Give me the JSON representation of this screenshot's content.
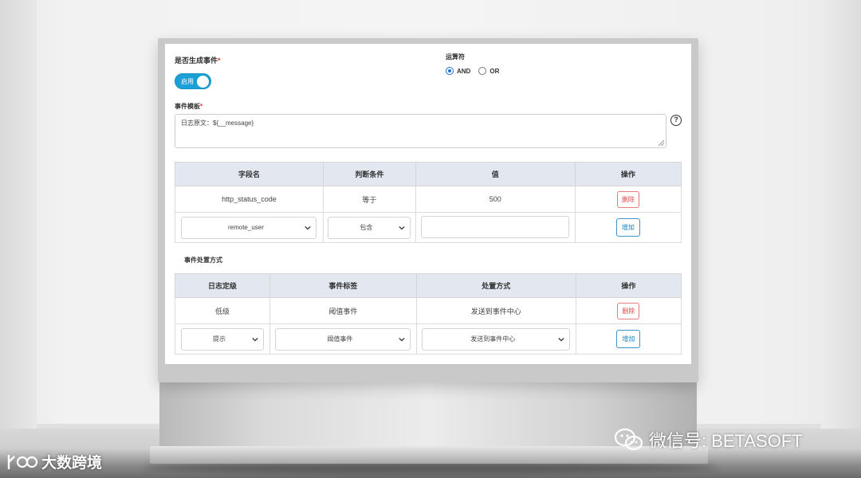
{
  "form": {
    "generate_event_label": "是否生成事件",
    "required_mark": "*",
    "toggle_text": "启用",
    "operator_label": "运算符",
    "operator_options": [
      "AND",
      "OR"
    ],
    "template_label": "事件模板",
    "template_value": "日志原文：${__message}",
    "help_glyph": "?"
  },
  "conditions_table": {
    "headers": [
      "字段名",
      "判断条件",
      "值",
      "操作"
    ],
    "row": {
      "field": "http_status_code",
      "condition": "等于",
      "value": "500",
      "action": "删除"
    },
    "input_row": {
      "field_select": "remote_user",
      "condition_select": "包含",
      "value_input": "",
      "action": "增加"
    }
  },
  "handling_label": "事件处置方式",
  "handling_table": {
    "headers": [
      "日志定级",
      "事件标签",
      "处置方式",
      "操作"
    ],
    "row": {
      "level": "低级",
      "tag": "阈值事件",
      "method": "发送到事件中心",
      "action": "删除"
    },
    "input_row": {
      "level_select": "提示",
      "tag_select": "阈值事件",
      "method_select": "发送到事件中心",
      "action": "增加"
    }
  },
  "watermarks": {
    "wechat": "微信号: BETASOFT",
    "logo": "大数跨境"
  }
}
